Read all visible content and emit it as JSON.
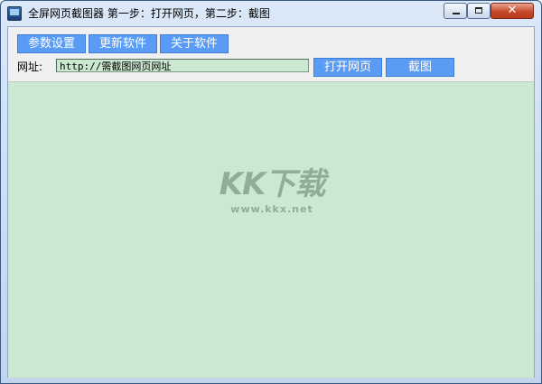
{
  "window": {
    "title": "全屏网页截图器 第一步：打开网页，第二步：截图",
    "controls": {
      "close_glyph": "✕"
    }
  },
  "toolbar": {
    "params_label": "参数设置",
    "update_label": "更新软件",
    "about_label": "关于软件"
  },
  "url": {
    "label": "网址:",
    "value": "http://需截图网页网址"
  },
  "actions": {
    "open_label": "打开网页",
    "capture_label": "截图"
  },
  "watermark": {
    "brand": "KK下载",
    "site": "www.kkx.net"
  },
  "colors": {
    "button_bg": "#5a9cf5",
    "preview_bg": "#cde8d0",
    "client_bg": "#f0f0f0"
  }
}
